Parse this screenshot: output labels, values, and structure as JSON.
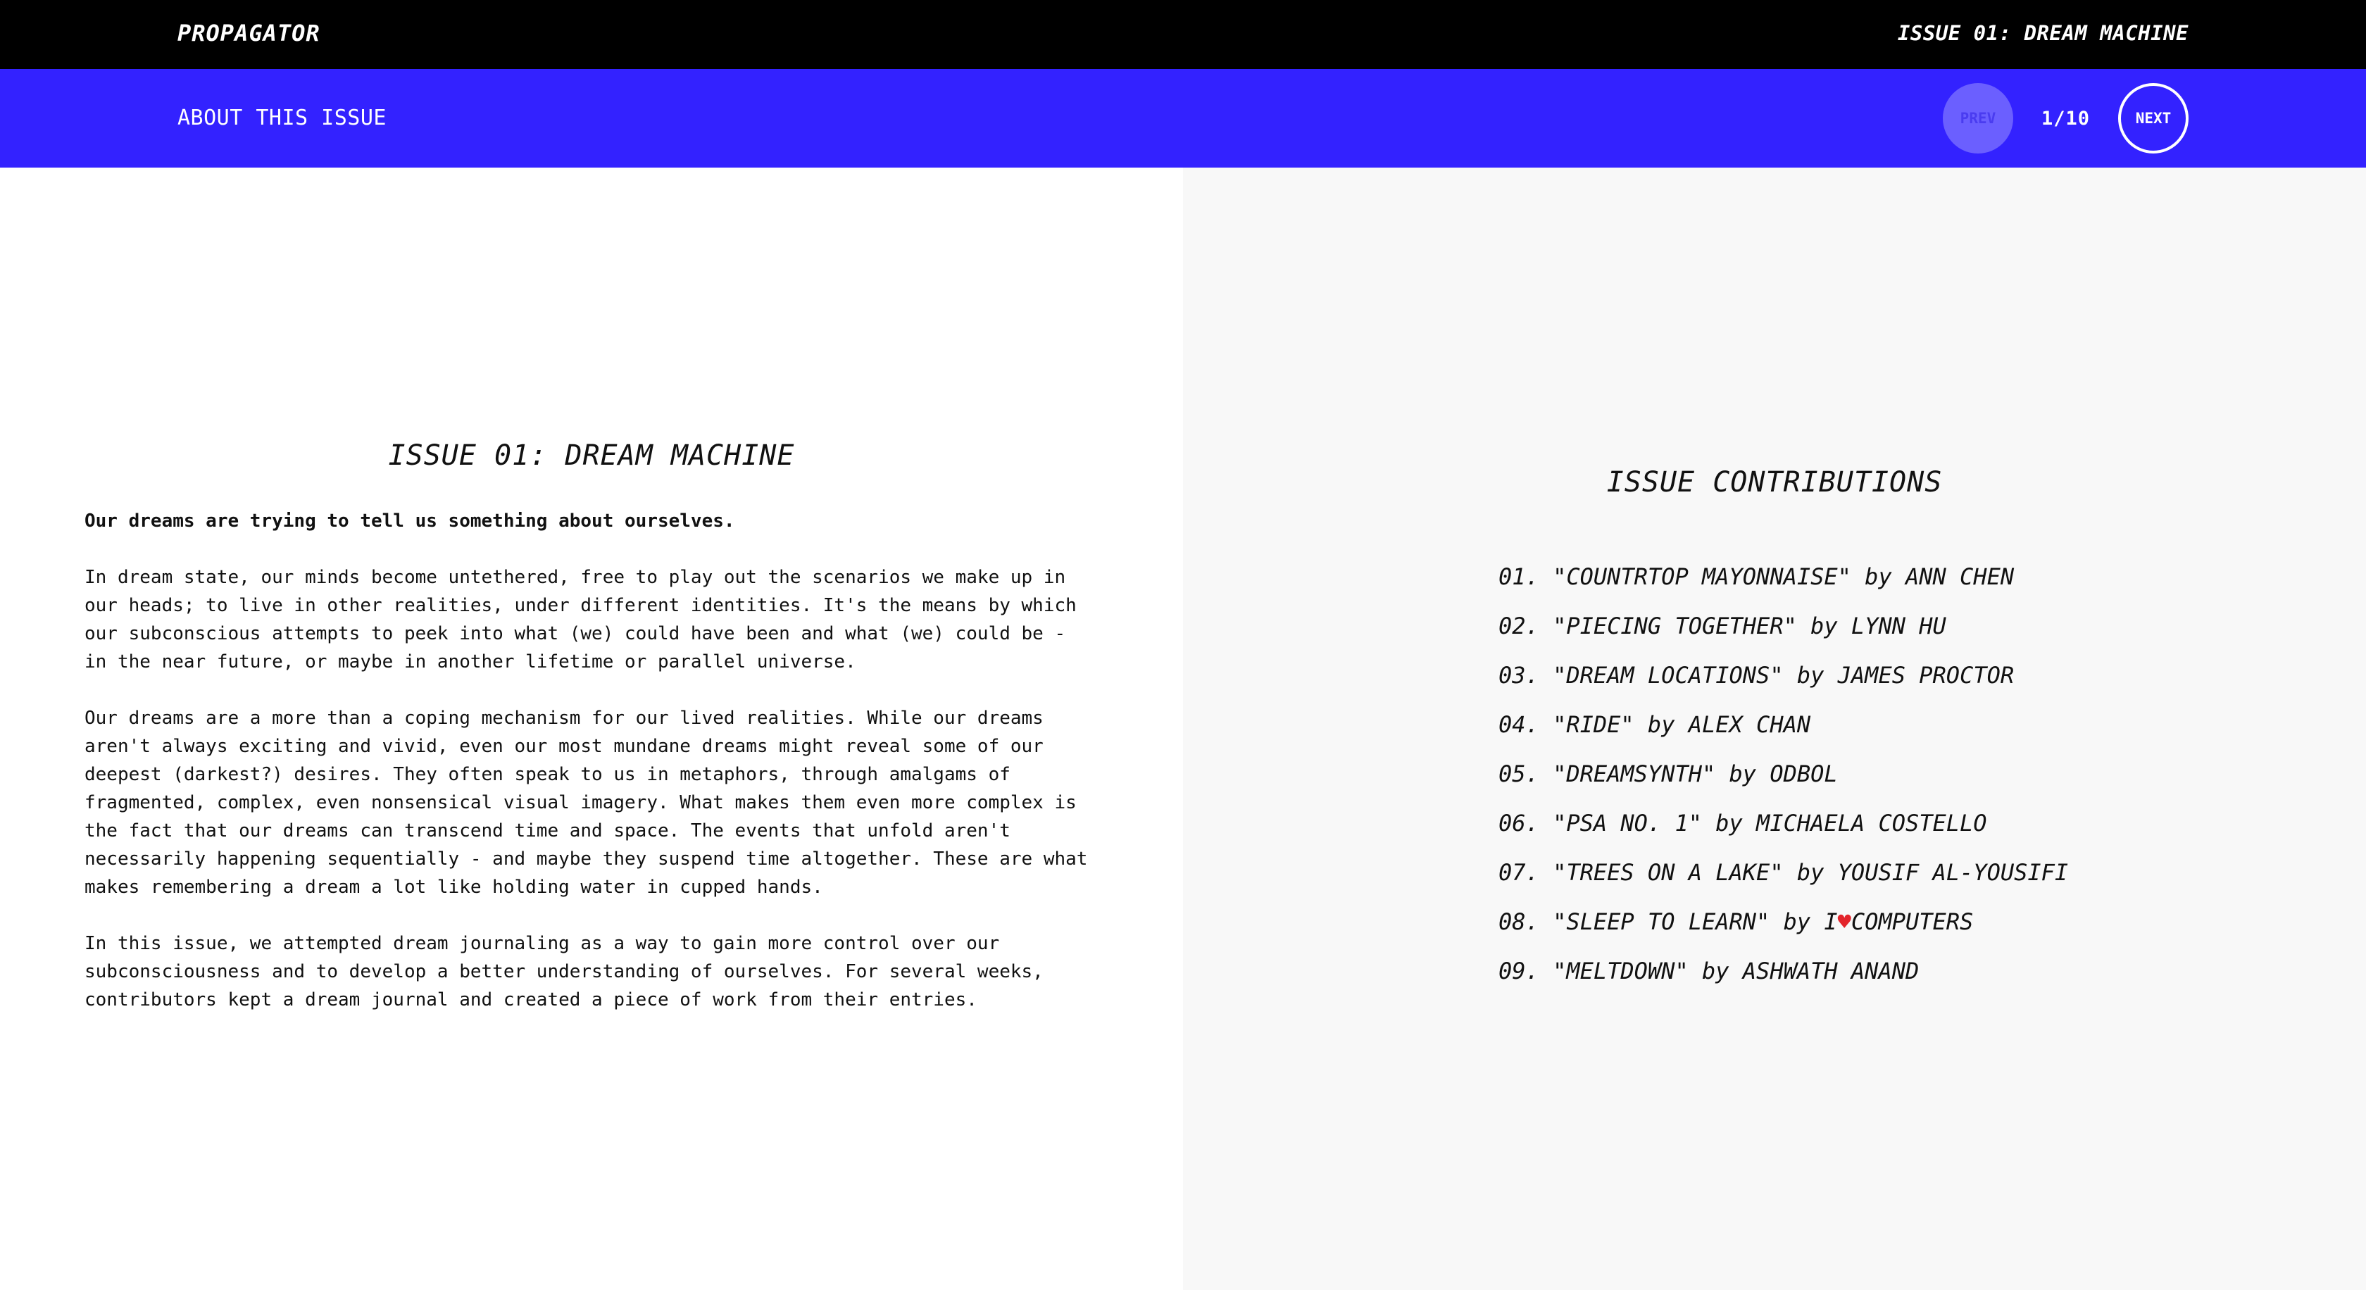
{
  "header": {
    "brand": "PROPAGATOR",
    "issue_name": "ISSUE 01: DREAM MACHINE"
  },
  "subheader": {
    "about_label": "ABOUT THIS ISSUE",
    "prev_label": "PREV",
    "counter": "1/10",
    "next_label": "NEXT"
  },
  "article": {
    "title": "ISSUE 01: DREAM MACHINE",
    "lead": "Our dreams are trying to tell us something about ourselves.",
    "paragraphs": [
      "In dream state, our minds become untethered, free to play out the scenarios we make up in our heads; to live in other realities, under different identities. It's the means by which our subconscious attempts to peek into what (we) could have been and what (we) could be - in the near future, or maybe in another lifetime or parallel universe.",
      "Our dreams are a more than a coping mechanism for our lived realities. While our dreams aren't always exciting and vivid, even our most mundane dreams might reveal some of our deepest (darkest?) desires. They often speak to us in metaphors, through amalgams of fragmented, complex, even nonsensical visual imagery. What makes them even more complex is the fact that our dreams can transcend time and space. The events that unfold aren't necessarily happening sequentially - and maybe they suspend time altogether. These are what makes remembering a dream a lot like holding water in cupped hands.",
      "In this issue, we attempted dream journaling as a way to gain more control over our subconsciousness and to develop a better understanding of ourselves. For several weeks, contributors kept a dream journal and created a piece of work from their entries."
    ]
  },
  "contributions": {
    "title": "ISSUE CONTRIBUTIONS",
    "items": [
      {
        "num": "01.",
        "work": "\"COUNTRTOP MAYONNAISE\"",
        "by": "by",
        "author": "ANN CHEN"
      },
      {
        "num": "02.",
        "work": "\"PIECING TOGETHER\"",
        "by": "by",
        "author": "LYNN HU"
      },
      {
        "num": "03.",
        "work": "\"DREAM LOCATIONS\"",
        "by": "by",
        "author": "JAMES PROCTOR"
      },
      {
        "num": "04.",
        "work": "\"RIDE\"",
        "by": "by",
        "author": "ALEX CHAN"
      },
      {
        "num": "05.",
        "work": "\"DREAMSYNTH\"",
        "by": "by",
        "author": "ODBOL"
      },
      {
        "num": "06.",
        "work": "\"PSA NO. 1\"",
        "by": "by",
        "author": "MICHAELA COSTELLO"
      },
      {
        "num": "07.",
        "work": "\"TREES ON A LAKE\"",
        "by": "by",
        "author": "YOUSIF AL-YOUSIFI"
      },
      {
        "num": "08.",
        "work": "\"SLEEP TO LEARN\"",
        "by": "by",
        "author_prefix": "I",
        "author_suffix": "COMPUTERS"
      },
      {
        "num": "09.",
        "work": "\"MELTDOWN\"",
        "by": "by",
        "author": "ASHWATH ANAND"
      }
    ]
  },
  "icons": {
    "heart": "heart-icon"
  },
  "colors": {
    "topbar": "#000000",
    "accent": "#3322ff",
    "right_panel": "#f8f8f8",
    "heart": "#e3242b"
  }
}
